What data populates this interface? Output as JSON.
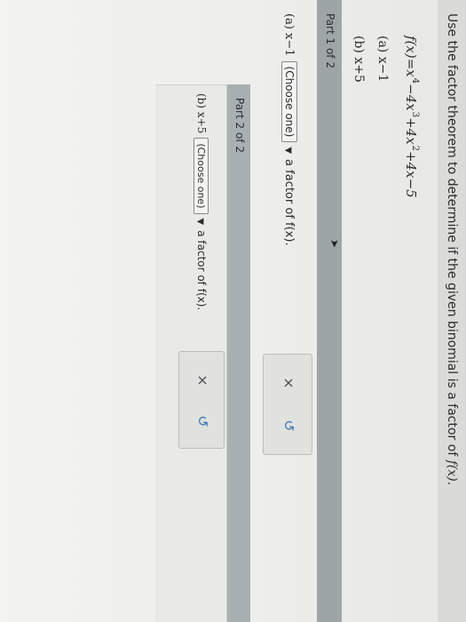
{
  "question": {
    "instruction": "Use the factor theorem to determine if the given binomial is a factor of ",
    "fx_suffix": "f(x).",
    "function_lhs": "f(x)=x",
    "function_rest": "−4x",
    "function_rest2": "+4x",
    "function_tail": "+4x−5",
    "exp4": "4",
    "exp3": "3",
    "exp2": "2",
    "option_a": "(a) x−1",
    "option_b": "(b) x+5"
  },
  "part1": {
    "title": "Part 1 of 2",
    "prompt_prefix": "(a) x−1",
    "select_value": "(Choose one)",
    "prompt_suffix": "a factor of f(x).",
    "clear_icon": "×",
    "redo_icon": "↺"
  },
  "part2": {
    "title": "Part 2 of 2",
    "prompt_prefix": "(b) x+5",
    "select_value": "(Choose one)",
    "prompt_suffix": "a factor of f(x).",
    "clear_icon": "×",
    "redo_icon": "↺"
  },
  "cursor_icon": "➤"
}
